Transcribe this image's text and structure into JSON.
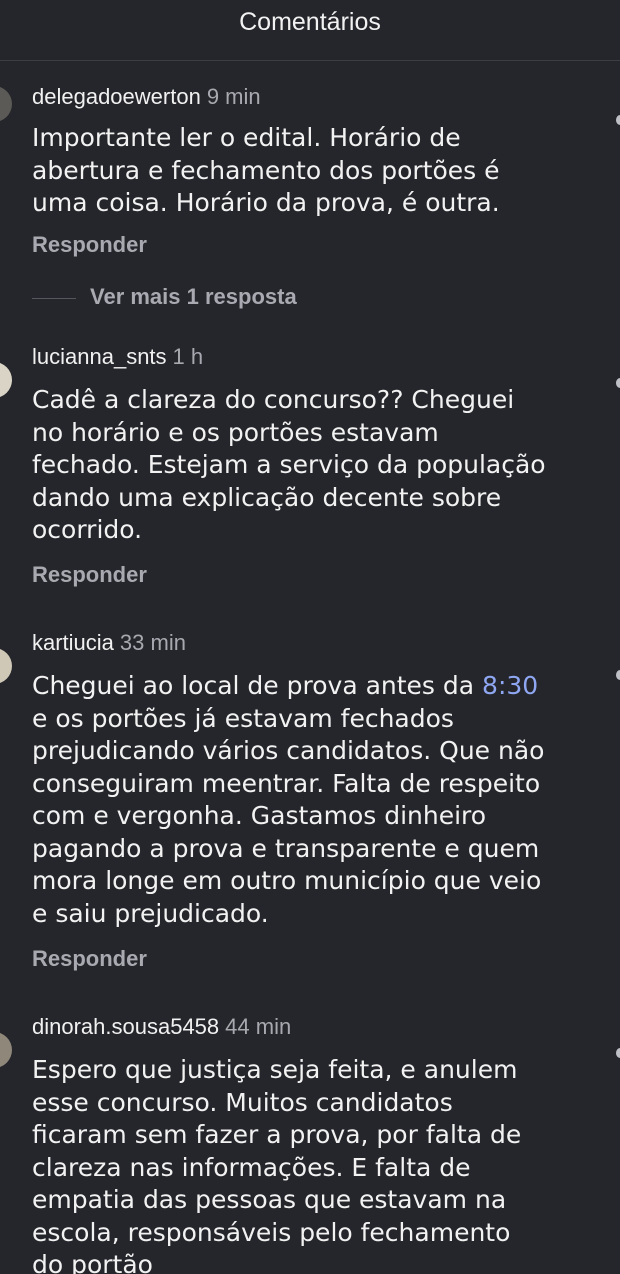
{
  "header": {
    "title": "Comentários"
  },
  "thread_1": {
    "username": "delegadoewerton",
    "time": "9 min",
    "lines": [
      "Importante ler o edital. Horário de",
      "abertura e fechamento dos portões é",
      "uma coisa. Horário da prova, é outra."
    ],
    "reply_label": "Responder",
    "more_replies_label": "Ver mais 1 resposta"
  },
  "comment_2": {
    "username": "lucianna_snts",
    "time": "1 h",
    "lines": [
      "Cadê a clareza do concurso?? Cheguei",
      "no horário e os portões estavam",
      "fechado. Estejam a serviço da população",
      "dando uma explicação decente sobre",
      "ocorrido."
    ],
    "reply_label": "Responder"
  },
  "comment_3": {
    "username": "kartiucia",
    "time": "33 min",
    "line1_prefix": "Cheguei ao local de prova antes da ",
    "line1_link": "8:30",
    "lines": [
      "e os portões já estavam fechados",
      "prejudicando vários candidatos. Que não",
      "conseguiram meentrar. Falta de respeito",
      "com e vergonha. Gastamos dinheiro",
      "pagando a prova e transparente e quem",
      "mora longe em outro município que veio",
      "e saiu prejudicado."
    ],
    "reply_label": "Responder"
  },
  "comment_4": {
    "username": "dinorah.sousa5458",
    "time": "44 min",
    "lines": [
      "Espero que justiça seja feita, e anulem",
      "esse concurso. Muitos candidatos",
      "ficaram sem fazer a prova, por falta de",
      "clareza nas informações. E falta de",
      "empatia das pessoas que estavam na",
      "escola, responsáveis pelo fechamento",
      "do portão"
    ]
  },
  "colors": {
    "background": "#25262b",
    "text": "#f2f2f2",
    "muted": "#a9aab1",
    "link": "#8fa7f2"
  },
  "icons": [
    "avatar",
    "like-heart-icon"
  ]
}
